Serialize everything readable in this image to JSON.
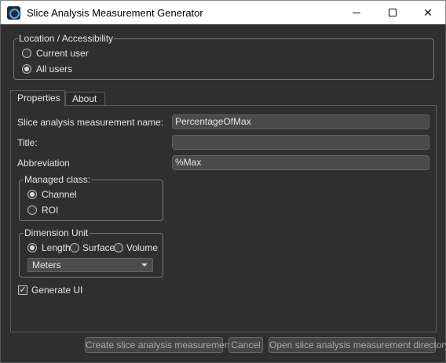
{
  "window": {
    "title": "Slice Analysis Measurement Generator"
  },
  "location": {
    "legend": "Location / Accessibility",
    "options": [
      {
        "label": "Current user",
        "selected": false
      },
      {
        "label": "All users",
        "selected": true
      }
    ]
  },
  "tabs": [
    {
      "label": "Properties",
      "active": true
    },
    {
      "label": "About",
      "active": false
    }
  ],
  "properties": {
    "name_label": "Slice analysis measurement name:",
    "name_value": "PercentageOfMax",
    "title_label": "Title:",
    "title_value": "",
    "abbreviation_label": "Abbreviation",
    "abbreviation_value": "%Max",
    "managed_class": {
      "legend": "Managed class:",
      "options": [
        {
          "label": "Channel",
          "selected": true
        },
        {
          "label": "ROI",
          "selected": false
        }
      ]
    },
    "dimension_unit": {
      "legend": "Dimension Unit",
      "options": [
        {
          "label": "Length",
          "selected": true
        },
        {
          "label": "Surface",
          "selected": false
        },
        {
          "label": "Volume",
          "selected": false
        }
      ],
      "unit_selected": "Meters"
    },
    "generate_ui": {
      "label": "Generate UI",
      "checked": true
    }
  },
  "buttons": {
    "create": "Create slice analysis measurement",
    "cancel": "Cancel",
    "open_dir": "Open slice analysis measurement directory"
  },
  "icons": {
    "app": "app-icon",
    "minimize": "minimize-icon",
    "maximize": "maximize-icon",
    "close": "close-icon",
    "dropdown": "chevron-down-icon",
    "check": "checkmark-icon"
  },
  "colors": {
    "background": "#2f2f2f",
    "field": "#4a4a4a",
    "text": "#e6e6e6",
    "disabled_text": "#a9a9a9"
  }
}
